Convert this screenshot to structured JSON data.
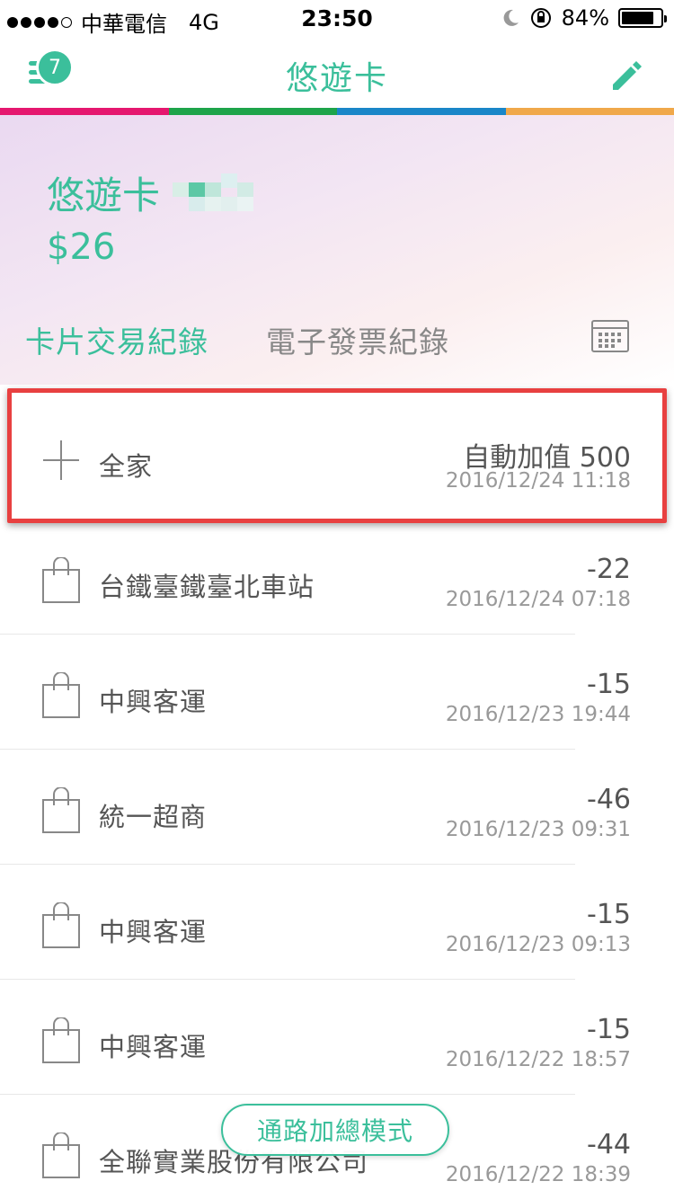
{
  "status_bar": {
    "carrier": "中華電信",
    "network": "4G",
    "time": "23:50",
    "battery": "84%",
    "battery_level": 0.84
  },
  "nav": {
    "title": "悠遊卡",
    "badge_count": "7",
    "menu_icon": "hamburger-menu-icon",
    "edit_icon": "pencil-icon"
  },
  "color_strip": [
    "#e5176f",
    "#1ea44a",
    "#1a86c8",
    "#f0a84a"
  ],
  "card": {
    "name": "悠遊卡",
    "balance": "$26"
  },
  "tabs": {
    "active": "卡片交易紀錄",
    "inactive": "電子發票紀錄"
  },
  "transactions": [
    {
      "type": "topup",
      "name": "全家",
      "amount": "自動加值  500",
      "date": "2016/12/24 11:18"
    },
    {
      "type": "purchase",
      "name": "台鐵臺鐵臺北車站",
      "amount": "-22",
      "date": "2016/12/24 07:18"
    },
    {
      "type": "purchase",
      "name": "中興客運",
      "amount": "-15",
      "date": "2016/12/23 19:44"
    },
    {
      "type": "purchase",
      "name": "統一超商",
      "amount": "-46",
      "date": "2016/12/23 09:31"
    },
    {
      "type": "purchase",
      "name": "中興客運",
      "amount": "-15",
      "date": "2016/12/23 09:13"
    },
    {
      "type": "purchase",
      "name": "中興客運",
      "amount": "-15",
      "date": "2016/12/22 18:57"
    },
    {
      "type": "purchase",
      "name": "全聯實業股份有限公司",
      "amount": "-44",
      "date": "2016/12/22 18:39"
    }
  ],
  "floating_button": "通路加總模式",
  "colors": {
    "accent": "#3bbf9b",
    "highlight_border": "#e84040"
  }
}
